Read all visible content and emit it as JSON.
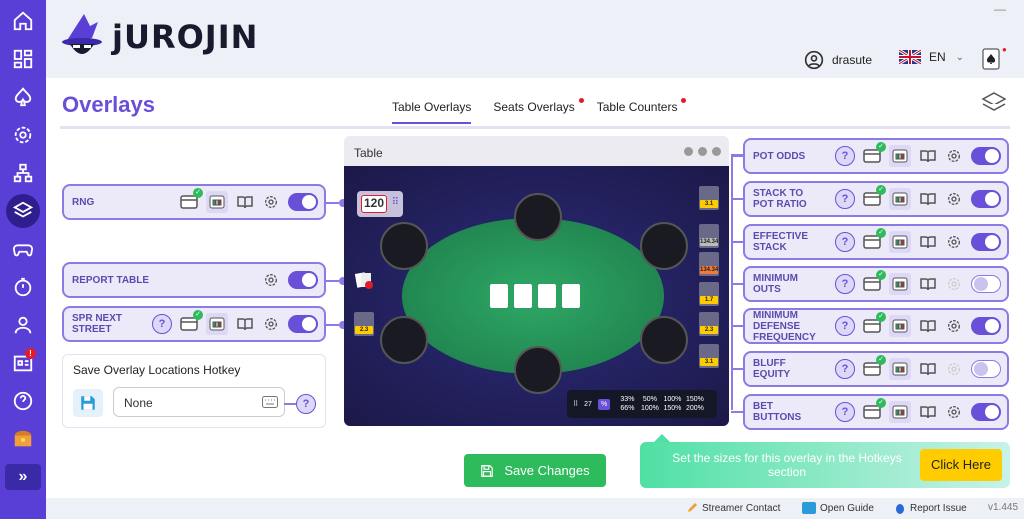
{
  "app": {
    "brand": "jUROJIN"
  },
  "header": {
    "username": "drasute",
    "language": "EN",
    "minimize": "—"
  },
  "sidebar": {
    "notification_badge": "!"
  },
  "page": {
    "title": "Overlays"
  },
  "tabs": [
    {
      "label": "Table Overlays",
      "active": true
    },
    {
      "label": "Seats Overlays",
      "dot": true
    },
    {
      "label": "Table Counters",
      "dot": true
    }
  ],
  "left_overlays": [
    {
      "label": "RNG"
    },
    {
      "label": "REPORT TABLE"
    },
    {
      "label": "SPR NEXT STREET"
    }
  ],
  "right_overlays": [
    {
      "label": "POT ODDS"
    },
    {
      "label": "STACK TO POT RATIO"
    },
    {
      "label": "EFFECTIVE STACK"
    },
    {
      "label": "MINIMUM OUTS"
    },
    {
      "label": "MINIMUM DEFENSE FREQUENCY"
    },
    {
      "label": "BLUFF EQUITY"
    },
    {
      "label": "BET BUTTONS"
    }
  ],
  "hotkey": {
    "title": "Save Overlay Locations Hotkey",
    "value": "None"
  },
  "table_preview": {
    "title": "Table",
    "rng_value": "120",
    "bet_sizes": {
      "count": "27",
      "unit": "%",
      "row1": [
        "33%",
        "50%",
        "100%",
        "150%"
      ],
      "row2": [
        "66%",
        "100%",
        "150%",
        "200%"
      ]
    },
    "mini_labels": [
      "3.1",
      "134.34",
      "134.34",
      "1.7",
      "2.3",
      "3.1",
      "2.3"
    ]
  },
  "buttons": {
    "save_changes": "Save Changes",
    "click_here": "Click Here"
  },
  "banner": {
    "text": "Set the sizes for this overlay in the Hotkeys section"
  },
  "footer": {
    "streamer": "Streamer Contact",
    "guide": "Open Guide",
    "report": "Report Issue",
    "version": "v1.445"
  },
  "colors": {
    "accent": "#6a4fd9",
    "sidebar": "#5a3fd6",
    "green": "#2dbb5c",
    "yellow": "#ffcc00"
  }
}
